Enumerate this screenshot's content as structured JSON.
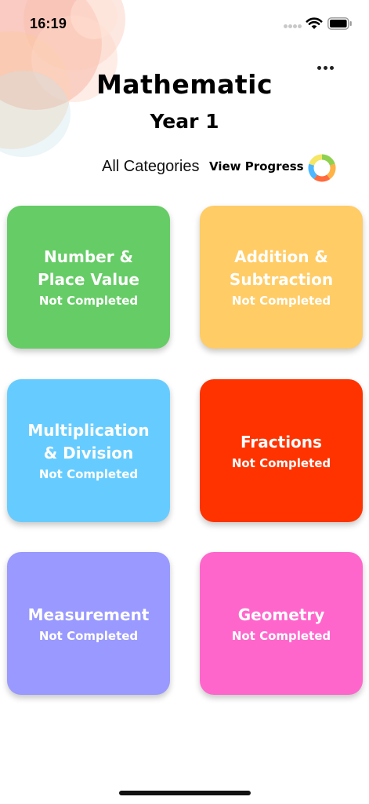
{
  "status_bar": {
    "time": "16:19"
  },
  "header": {
    "title": "Mathematic",
    "subtitle": "Year 1",
    "more_icon": "ellipsis-horizontal-icon"
  },
  "toolbar": {
    "categories_label": "All Categories",
    "view_progress_label": "View Progress",
    "progress_icon": "progress-ring-icon",
    "progress_colors": [
      "#8fd14f",
      "#ffb347",
      "#ff6b3d",
      "#4db8ff",
      "#f5e663"
    ]
  },
  "cards": [
    {
      "title": "Number &\nPlace Value",
      "status": "Not Completed",
      "color": "#66cc66"
    },
    {
      "title": "Addition &\nSubtraction",
      "status": "Not Completed",
      "color": "#ffcc66"
    },
    {
      "title": "Multiplication\n& Division",
      "status": "Not Completed",
      "color": "#66ccff"
    },
    {
      "title": "Fractions",
      "status": "Not Completed",
      "color": "#ff3300"
    },
    {
      "title": "Measurement",
      "status": "Not Completed",
      "color": "#9999ff"
    },
    {
      "title": "Geometry",
      "status": "Not Completed",
      "color": "#ff66cc"
    }
  ]
}
